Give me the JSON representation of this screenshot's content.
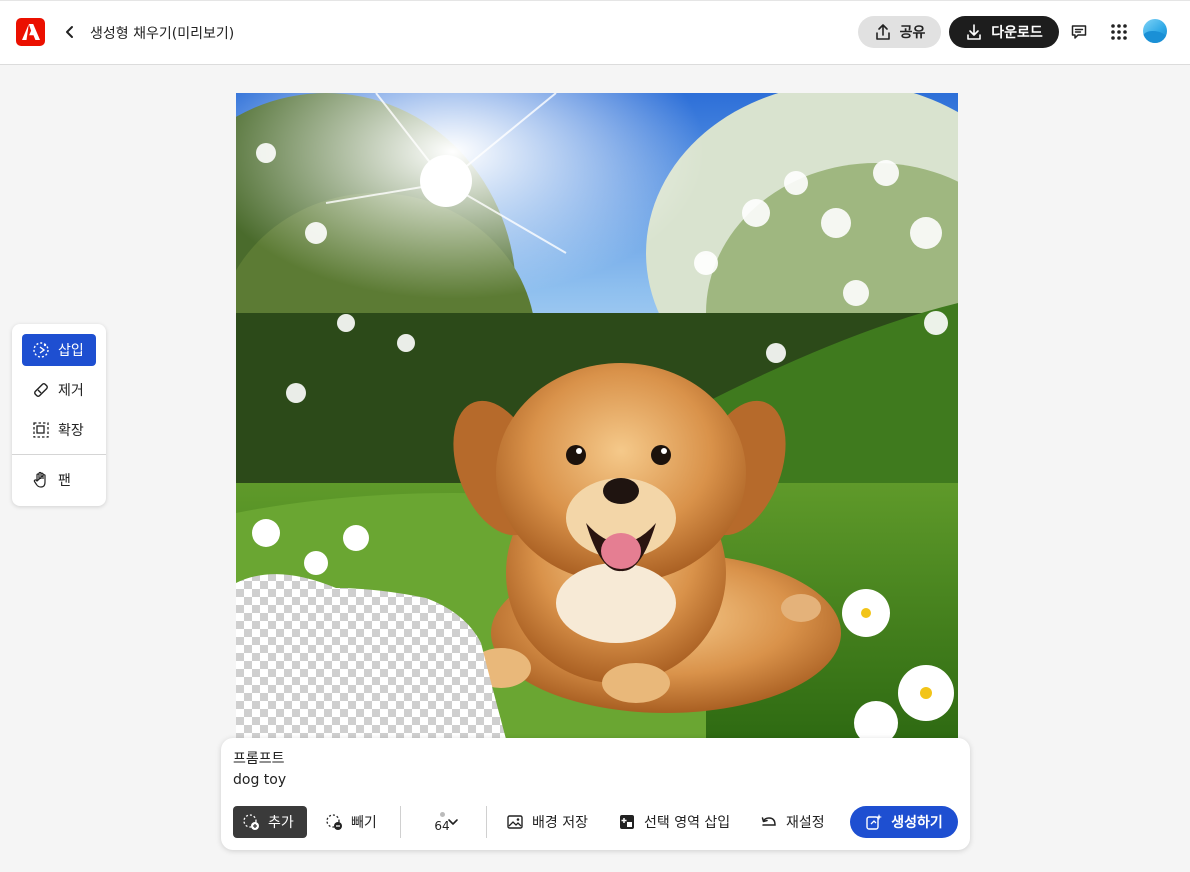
{
  "header": {
    "title": "생성형 채우기(미리보기)",
    "share_label": "공유",
    "download_label": "다운로드",
    "icons": [
      "adobe-logo",
      "back-chevron",
      "share-upload",
      "download",
      "comment",
      "apps-grid",
      "avatar"
    ]
  },
  "tools": {
    "items": [
      {
        "label": "삽입",
        "icon": "insert-icon",
        "active": true
      },
      {
        "label": "제거",
        "icon": "remove-icon"
      },
      {
        "label": "확장",
        "icon": "expand-icon"
      },
      {
        "label": "팬",
        "icon": "hand-icon"
      }
    ]
  },
  "prompt": {
    "label": "프롬프트",
    "value": "dog toy",
    "add_label": "추가",
    "subtract_label": "빼기",
    "brush_size": "64",
    "save_background_label": "배경 저장",
    "insert_selection_label": "선택 영역 삽입",
    "reset_label": "재설정",
    "generate_label": "생성하기"
  },
  "colors": {
    "accent": "#1e4fd1",
    "logo_red": "#eb1000",
    "download_bg": "#1d1d1d"
  }
}
